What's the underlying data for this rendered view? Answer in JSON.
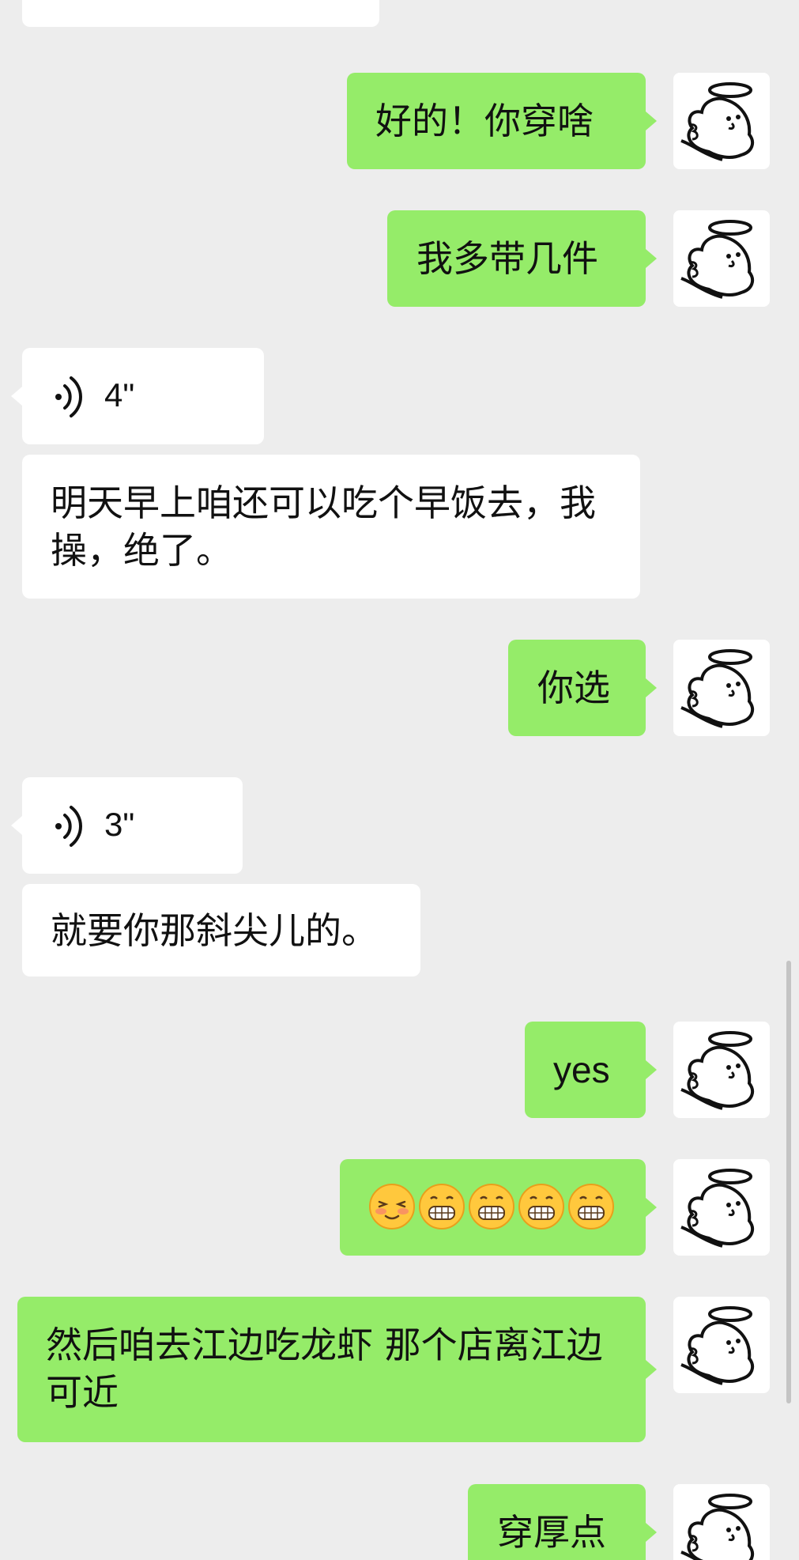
{
  "messages": {
    "top_partial": "",
    "m1": "好的！你穿啥",
    "m2": "我多带几件",
    "voice1_duration": "4\"",
    "m3": "明天早上咱还可以吃个早饭去，我操，绝了。",
    "m4": "你选",
    "voice2_duration": "3\"",
    "m5": "就要你那斜尖儿的。",
    "m6": "yes",
    "m7_emoji": [
      "smiling-blush-emoji",
      "grinning-teeth-emoji",
      "grinning-teeth-emoji",
      "grinning-teeth-emoji",
      "grinning-teeth-emoji"
    ],
    "m8": "然后咱去江边吃龙虾 那个店离江边可近",
    "m9": "穿厚点"
  },
  "colors": {
    "background": "#EDEDED",
    "outgoing_bubble": "#95EC69",
    "incoming_bubble": "#FFFFFF",
    "scrollbar": "#C4C4C4"
  },
  "icons": {
    "avatar": "angel-ghost-avatar-icon",
    "voice": "voice-wave-icon"
  }
}
